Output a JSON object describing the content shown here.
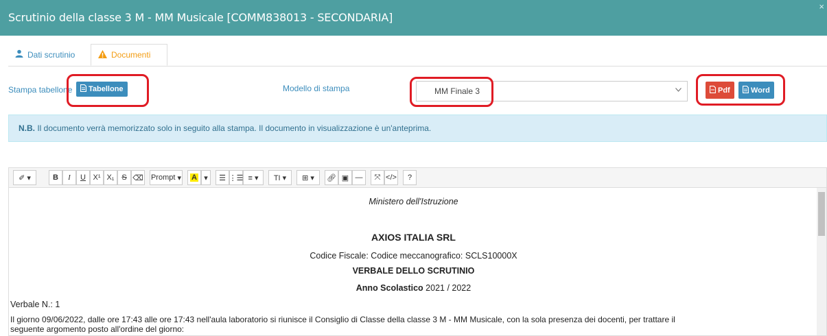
{
  "window": {
    "title": "Scrutinio della classe 3 M - MM Musicale [COMM838013 - SECONDARIA]",
    "close_label": "×"
  },
  "tabs": [
    {
      "label": "Dati scrutinio",
      "icon": "user-icon",
      "active": false
    },
    {
      "label": "Documenti",
      "icon": "warning-icon",
      "active": true
    }
  ],
  "print_row": {
    "stampa_label": "Stampa tabellone",
    "tabellone_button": "Tabellone",
    "modello_label": "Modello di stampa",
    "modello_value": "MM Finale 3",
    "pdf_button": "Pdf",
    "word_button": "Word"
  },
  "note": {
    "bold": "N.B.",
    "text": " Il documento verrà memorizzato solo in seguito alla stampa. Il documento in visualizzazione è un'anteprima."
  },
  "toolbar": {
    "prompt_label": "Prompt",
    "icons": [
      "magic-wand-icon",
      "bold-icon",
      "italic-icon",
      "underline-icon",
      "superscript-icon",
      "subscript-icon",
      "strikethrough-icon",
      "eraser-icon",
      "prompt-dropdown",
      "text-color-icon",
      "bullet-list-icon",
      "numbered-list-icon",
      "align-icon",
      "font-size-icon",
      "table-icon",
      "link-icon",
      "image-icon",
      "horizontal-rule-icon",
      "fullscreen-icon",
      "code-view-icon",
      "help-icon"
    ]
  },
  "document": {
    "ministero": "Ministero dell'Istruzione",
    "company": "AXIOS ITALIA SRL",
    "codice": "Codice Fiscale: Codice meccanografico: SCLS10000X",
    "verbale_title": "VERBALE DELLO SCRUTINIO",
    "anno_label": "Anno Scolastico",
    "anno_value": " 2021 / 2022",
    "verbale_n": "Verbale N.: 1",
    "paragraph_1": "Il giorno 09/06/2022, dalle ore 17:43 alle ore 17:43 nell'aula laboratorio si riunisce il Consiglio di Classe della classe 3 M - MM Musicale, con la sola presenza dei docenti, per trattare il",
    "paragraph_2": "seguente argomento posto all'ordine del giorno:"
  },
  "colors": {
    "titlebar": "#4e9fa1",
    "primary": "#3c8dbc",
    "danger": "#dd4b39",
    "warning": "#f39c12",
    "highlight": "#e01b24",
    "info_bg": "#d9edf7"
  }
}
